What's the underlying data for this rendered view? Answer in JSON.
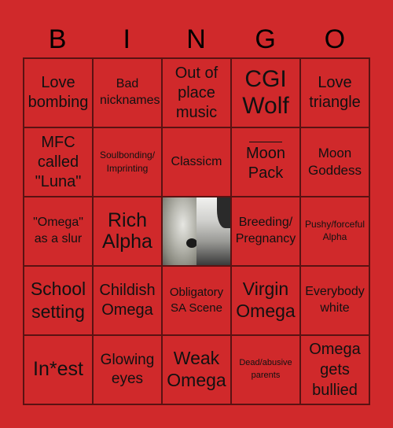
{
  "header": {
    "letters": [
      "B",
      "I",
      "N",
      "G",
      "O"
    ]
  },
  "board": {
    "rows": [
      [
        "Love bombing",
        "Bad nicknames",
        "Out of place music",
        "CGI Wolf",
        "Love triangle"
      ],
      [
        "MFC called \"Luna\"",
        "Soulbonding/ Imprinting",
        "Classicm",
        "Moon Pack",
        "Moon Goddess"
      ],
      [
        "\"Omega\" as a slur",
        "Rich Alpha",
        "",
        "Breeding/ Pregnancy",
        "Pushy/forceful Alpha"
      ],
      [
        "School setting",
        "Childish Omega",
        "Obligatory SA Scene",
        "Virgin Omega",
        "Everybody white"
      ],
      [
        "In*est",
        "Glowing eyes",
        "Weak Omega",
        "Dead/abusive parents",
        "Omega gets bullied"
      ]
    ],
    "free_space": {
      "image": "wolf-man-split-portrait"
    }
  },
  "colors": {
    "background": "#d0292b",
    "grid_line": "#5a1212",
    "text": "#111111"
  }
}
